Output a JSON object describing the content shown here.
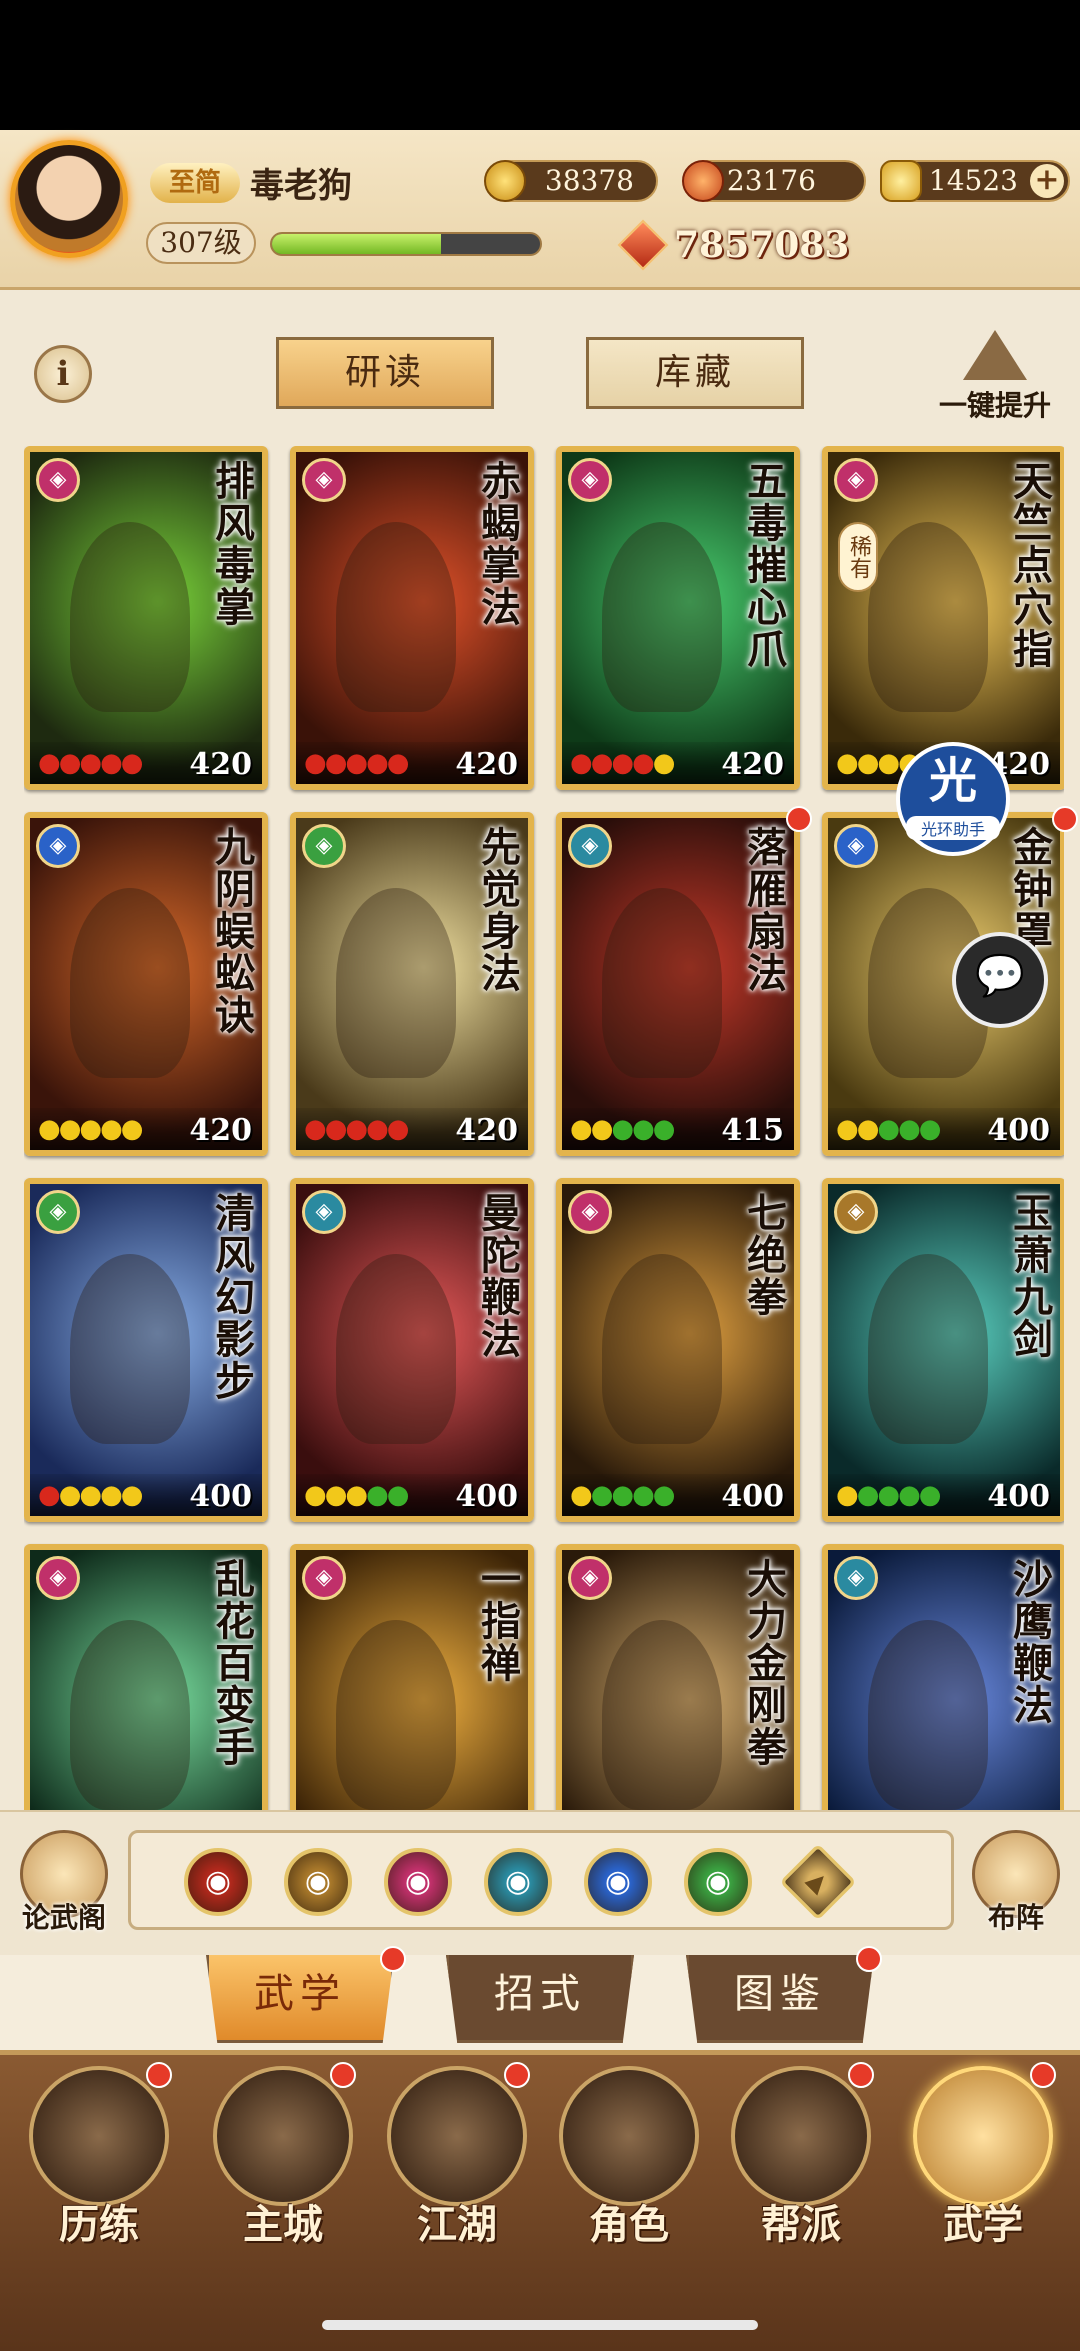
{
  "player": {
    "vip": "至简",
    "name": "毒老狗",
    "level": "307级",
    "exp_fraction": 0.63,
    "power": "7857083"
  },
  "currencies": [
    {
      "icon": "coin-icon",
      "value": "38378"
    },
    {
      "icon": "lotus-icon",
      "value": "23176"
    },
    {
      "icon": "gold-ingot-icon",
      "value": "14523"
    }
  ],
  "tabs": {
    "read": "研读",
    "store": "库藏"
  },
  "upgrade_label": "一键提升",
  "cards": [
    {
      "title": "排风毒掌",
      "level": "420",
      "sect": "#c0306a",
      "art": [
        "#1e2a10",
        "#7ad43a"
      ],
      "pips": [
        "r",
        "r",
        "r",
        "r",
        "r"
      ]
    },
    {
      "title": "赤蝎掌法",
      "level": "420",
      "sect": "#c0306a",
      "art": [
        "#3a1208",
        "#e2522a"
      ],
      "pips": [
        "r",
        "r",
        "r",
        "r",
        "r"
      ]
    },
    {
      "title": "五毒摧心爪",
      "level": "420",
      "sect": "#c0306a",
      "art": [
        "#0e3a18",
        "#4ad070"
      ],
      "pips": [
        "r",
        "r",
        "r",
        "r",
        "y"
      ]
    },
    {
      "title": "天竺点穴指",
      "level": "420",
      "sect": "#c0306a",
      "art": [
        "#3a2a0a",
        "#f2c85a"
      ],
      "pips": [
        "y",
        "y",
        "y",
        "y",
        "y"
      ],
      "rare": "稀有"
    },
    {
      "title": "九阴蜈蚣诀",
      "level": "420",
      "sect": "#2a62c8",
      "art": [
        "#3a140a",
        "#d86a2a"
      ],
      "pips": [
        "y",
        "y",
        "y",
        "y",
        "y"
      ]
    },
    {
      "title": "先觉身法",
      "level": "420",
      "sect": "#3aa040",
      "art": [
        "#4a3a1a",
        "#f2e2a2"
      ],
      "pips": [
        "r",
        "r",
        "r",
        "r",
        "r"
      ]
    },
    {
      "title": "落雁扇法",
      "level": "415",
      "sect": "#2a8aa0",
      "art": [
        "#2a0e0a",
        "#c83a2a"
      ],
      "pips": [
        "y",
        "y",
        "g",
        "g",
        "g"
      ]
    },
    {
      "title": "金钟罩",
      "level": "400",
      "sect": "#2a62c8",
      "art": [
        "#4a3a10",
        "#f0d070"
      ],
      "pips": [
        "y",
        "y",
        "g",
        "g",
        "g"
      ]
    },
    {
      "title": "清风幻影步",
      "level": "400",
      "sect": "#3aa040",
      "art": [
        "#1a2a5a",
        "#8ab0e8"
      ],
      "pips": [
        "r",
        "y",
        "y",
        "y",
        "y"
      ]
    },
    {
      "title": "曼陀鞭法",
      "level": "400",
      "sect": "#2a8aa0",
      "art": [
        "#3a0e0e",
        "#e85a5a"
      ],
      "pips": [
        "y",
        "y",
        "y",
        "g",
        "g"
      ]
    },
    {
      "title": "七绝拳",
      "level": "400",
      "sect": "#c0306a",
      "art": [
        "#2a1a0a",
        "#e0a040"
      ],
      "pips": [
        "y",
        "g",
        "g",
        "g",
        "g"
      ]
    },
    {
      "title": "玉萧九剑",
      "level": "400",
      "sect": "#a8782a",
      "art": [
        "#0a2a2a",
        "#5ad0c0"
      ],
      "pips": [
        "y",
        "g",
        "g",
        "g",
        "g"
      ]
    },
    {
      "title": "乱花百变手",
      "level": "",
      "sect": "#c0306a",
      "art": [
        "#0e2a1a",
        "#7ae0a0"
      ],
      "pips": []
    },
    {
      "title": "一指禅",
      "level": "",
      "sect": "#c0306a",
      "art": [
        "#3a2206",
        "#f0b040"
      ],
      "pips": []
    },
    {
      "title": "大力金刚拳",
      "level": "",
      "sect": "#c0306a",
      "art": [
        "#2a1a0a",
        "#d8b070"
      ],
      "pips": []
    },
    {
      "title": "沙鹰鞭法",
      "level": "",
      "sect": "#2a8aa0",
      "art": [
        "#0a1a3a",
        "#6a8ae0"
      ],
      "pips": []
    }
  ],
  "halo_helper": {
    "big": "光",
    "small": "光环助手"
  },
  "left_button": "论武阁",
  "right_button": "布阵",
  "filters": [
    {
      "icon": "saber-sect-icon",
      "color": "#b0281c"
    },
    {
      "icon": "sword-sect-icon",
      "color": "#a8782a"
    },
    {
      "icon": "lotus-sect-icon",
      "color": "#c0306a"
    },
    {
      "icon": "fan-sect-icon",
      "color": "#2a8aa0"
    },
    {
      "icon": "taiji-sect-icon",
      "color": "#2a62c8"
    },
    {
      "icon": "swirl-sect-icon",
      "color": "#3aa040"
    },
    {
      "icon": "all-sect-icon",
      "color": "#d8b060"
    }
  ],
  "subtabs": [
    "武学",
    "招式",
    "图鉴"
  ],
  "nav": [
    "历练",
    "主城",
    "江湖",
    "角色",
    "帮派",
    "武学"
  ]
}
